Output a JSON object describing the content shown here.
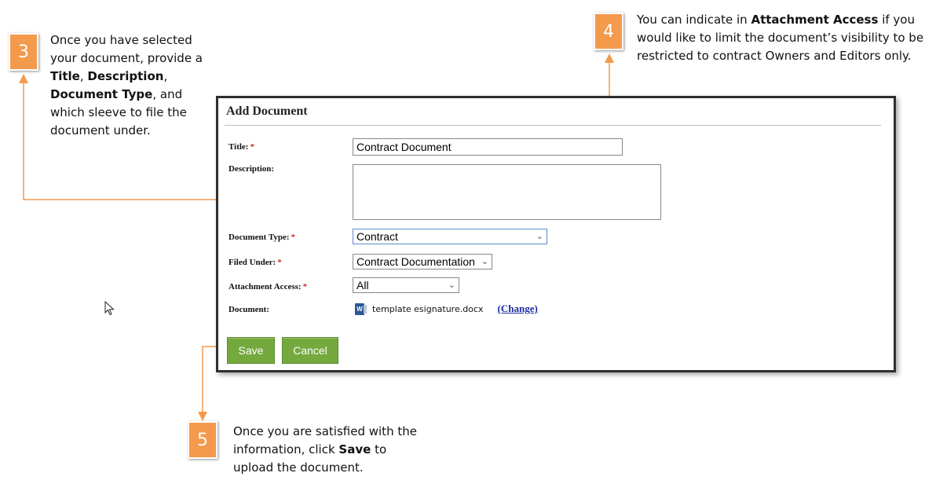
{
  "callouts": [
    {
      "number": "3",
      "text_parts": [
        {
          "t": "Once you have selected your document, provide a ",
          "b": false
        },
        {
          "t": "Title",
          "b": true
        },
        {
          "t": ", ",
          "b": false
        },
        {
          "t": "Description",
          "b": true
        },
        {
          "t": ", ",
          "b": false
        },
        {
          "t": "Document Type",
          "b": true
        },
        {
          "t": ", and which sleeve to file the document under.",
          "b": false
        }
      ]
    },
    {
      "number": "4",
      "text_parts": [
        {
          "t": "You can indicate in ",
          "b": false
        },
        {
          "t": "Attachment Access",
          "b": true
        },
        {
          "t": " if you would like to limit the document’s visibility to be restricted to contract Owners and Editors only.",
          "b": false
        }
      ]
    },
    {
      "number": "5",
      "text_parts": [
        {
          "t": "Once you are satisfied with the information, click ",
          "b": false
        },
        {
          "t": "Save",
          "b": true
        },
        {
          "t": " to upload the document.",
          "b": false
        }
      ]
    }
  ],
  "dialog": {
    "title": "Add Document",
    "required_marker": "*",
    "fields": {
      "title": {
        "label": "Title:",
        "value": "Contract Document"
      },
      "description": {
        "label": "Description:",
        "value": ""
      },
      "document_type": {
        "label": "Document Type:",
        "value": "Contract"
      },
      "filed_under": {
        "label": "Filed Under:",
        "value": "Contract Documentation"
      },
      "attachment_access": {
        "label": "Attachment Access:",
        "value": "All"
      },
      "document": {
        "label": "Document:",
        "filename": "template esignature.docx",
        "change_label": "(Change)"
      }
    },
    "buttons": {
      "save": "Save",
      "cancel": "Cancel"
    }
  },
  "colors": {
    "callout": "#f39a4c",
    "button": "#74a93e",
    "link": "#1a2aa6",
    "required": "#d12a2a"
  },
  "icons": [
    "word-document-icon",
    "chevron-down-icon",
    "mouse-pointer-icon"
  ]
}
